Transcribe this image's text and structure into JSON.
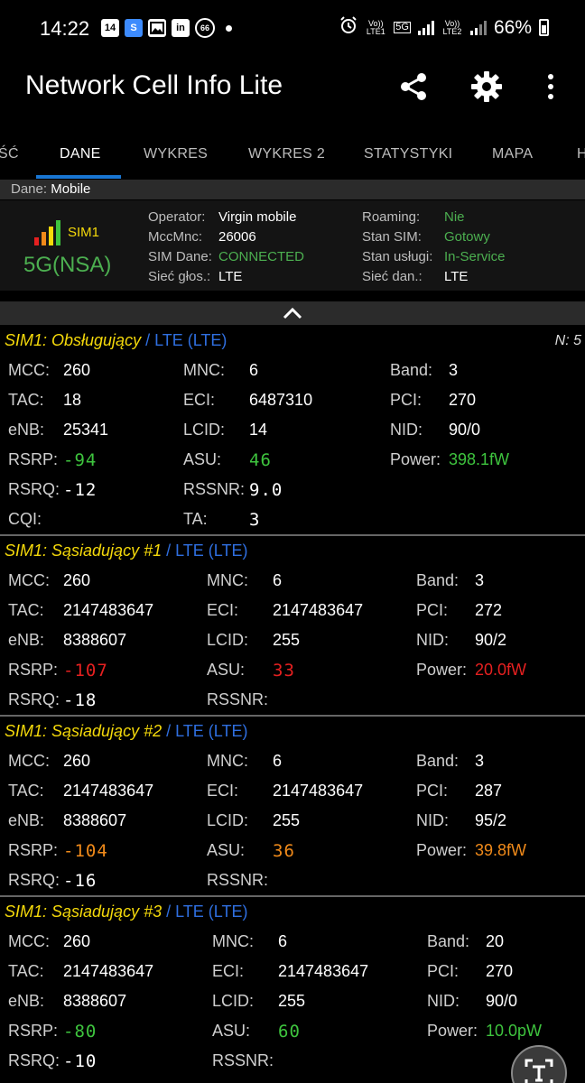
{
  "status_bar": {
    "time": "14:22",
    "left_icons": [
      "14",
      "S",
      "image-icon",
      "in",
      "66"
    ],
    "volte1": "Vo)) LTE1",
    "volte2": "Vo)) LTE2",
    "net": "5G",
    "battery": "66%"
  },
  "app": {
    "title": "Network Cell Info Lite"
  },
  "tabs": [
    "ŚĆ",
    "DANE",
    "WYKRES",
    "WYKRES 2",
    "STATYSTYKI",
    "MAPA",
    "H"
  ],
  "active_tab": "DANE",
  "data_source": {
    "label": "Dane:",
    "value": "Mobile"
  },
  "summary": {
    "sim": "SIM1",
    "network_type": "5G(NSA)",
    "operator_label": "Operator:",
    "operator": "Virgin mobile",
    "mccmnc_label": "MccMnc:",
    "mccmnc": "26006",
    "sim_data_label": "SIM Dane:",
    "sim_data": "CONNECTED",
    "voice_label": "Sieć głos.:",
    "voice": "LTE",
    "roaming_label": "Roaming:",
    "roaming": "Nie",
    "sim_state_label": "Stan SIM:",
    "sim_state": "Gotowy",
    "service_label": "Stan usługi:",
    "service": "In-Service",
    "data_net_label": "Sieć dan.:",
    "data_net": "LTE"
  },
  "cells": [
    {
      "title": "SIM1: Obsługujący",
      "tech": " / LTE (LTE)",
      "n": "N: 5",
      "mcc": "260",
      "mnc": "6",
      "band": "3",
      "tac": "18",
      "eci": "6487310",
      "pci": "270",
      "enb": "25341",
      "lcid": "14",
      "nid": "90/0",
      "rsrp": "-94",
      "asu": "46",
      "power": "398.1fW",
      "rsrq": "-12",
      "rssnr": "9.0",
      "cqi": "",
      "ta": "3",
      "color": "green"
    },
    {
      "title": "SIM1: Sąsiadujący #1",
      "tech": " / LTE (LTE)",
      "mcc": "260",
      "mnc": "6",
      "band": "3",
      "tac": "2147483647",
      "eci": "2147483647",
      "pci": "272",
      "enb": "8388607",
      "lcid": "255",
      "nid": "90/2",
      "rsrp": "-107",
      "asu": "33",
      "power": "20.0fW",
      "rsrq": "-18",
      "rssnr": "",
      "color": "red"
    },
    {
      "title": "SIM1: Sąsiadujący #2",
      "tech": " / LTE (LTE)",
      "mcc": "260",
      "mnc": "6",
      "band": "3",
      "tac": "2147483647",
      "eci": "2147483647",
      "pci": "287",
      "enb": "8388607",
      "lcid": "255",
      "nid": "95/2",
      "rsrp": "-104",
      "asu": "36",
      "power": "39.8fW",
      "rsrq": "-16",
      "rssnr": "",
      "color": "orange"
    },
    {
      "title": "SIM1: Sąsiadujący #3",
      "tech": " / LTE (LTE)",
      "mcc": "260",
      "mnc": "6",
      "band": "20",
      "tac": "2147483647",
      "eci": "2147483647",
      "pci": "270",
      "enb": "8388607",
      "lcid": "255",
      "nid": "90/0",
      "rsrp": "-80",
      "asu": "60",
      "power": "10.0pW",
      "rsrq": "-10",
      "rssnr": "",
      "color": "green"
    }
  ],
  "labels": {
    "mcc": "MCC:",
    "mnc": "MNC:",
    "band": "Band:",
    "tac": "TAC:",
    "eci": "ECI:",
    "pci": "PCI:",
    "enb": "eNB:",
    "lcid": "LCID:",
    "nid": "NID:",
    "rsrp": "RSRP:",
    "asu": "ASU:",
    "power": "Power:",
    "rsrq": "RSRQ:",
    "rssnr": "RSSNR:",
    "cqi": "CQI:",
    "ta": "TA:"
  },
  "colors": {
    "accent": "#1976d2",
    "green": "#3ec43e",
    "red": "#e52020",
    "orange": "#f08a1a",
    "yellow": "#f5d90a",
    "tech_blue": "#2f6fe0"
  }
}
